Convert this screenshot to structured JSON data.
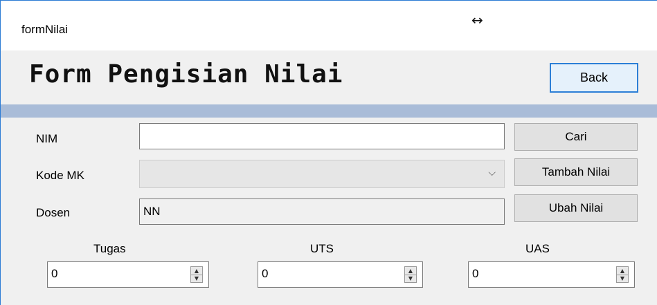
{
  "window": {
    "title": "formNilai"
  },
  "header": {
    "title": "Form Pengisian Nilai",
    "back_label": "Back"
  },
  "form": {
    "nim": {
      "label": "NIM",
      "value": ""
    },
    "kode_mk": {
      "label": "Kode MK",
      "value": ""
    },
    "dosen": {
      "label": "Dosen",
      "value": "NN"
    }
  },
  "actions": {
    "cari": "Cari",
    "tambah": "Tambah Nilai",
    "ubah": "Ubah Nilai"
  },
  "scores": {
    "tugas": {
      "label": "Tugas",
      "value": "0"
    },
    "uts": {
      "label": "UTS",
      "value": "0"
    },
    "uas": {
      "label": "UAS",
      "value": "0"
    }
  },
  "icons": {
    "resize_cursor": "↔",
    "dropdown": "chevron-down-icon",
    "spinner": "updown-spinner-icon"
  }
}
